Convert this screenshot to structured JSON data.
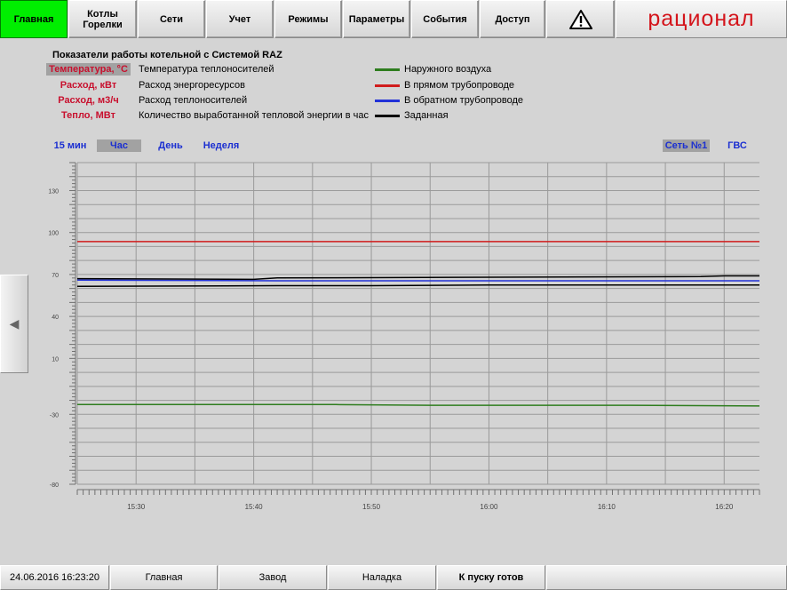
{
  "nav": {
    "items": [
      {
        "label": "Главная",
        "active": true
      },
      {
        "label": "Котлы\nГорелки"
      },
      {
        "label": "Сети"
      },
      {
        "label": "Учет"
      },
      {
        "label": "Режимы"
      },
      {
        "label": "Параметры"
      },
      {
        "label": "События"
      },
      {
        "label": "Доступ"
      }
    ],
    "alarm_icon": "warning-triangle-icon",
    "brand": "рационал"
  },
  "header": {
    "title": "Показатели работы котельной с Системой RAZ"
  },
  "legend": {
    "params": [
      {
        "name": "Температура, °С",
        "desc": "Температура теплоносителей",
        "selected": true
      },
      {
        "name": "Расход, кВт",
        "desc": "Расход энергоресурсов"
      },
      {
        "name": "Расход, м3/ч",
        "desc": "Расход теплоносителей"
      },
      {
        "name": "Тепло, МВт",
        "desc": "Количество выработанной тепловой энергии в час"
      }
    ],
    "series": [
      {
        "label": "Наружного воздуха",
        "color": "#2e7d1e"
      },
      {
        "label": "В прямом трубопроводе",
        "color": "#d01c1c"
      },
      {
        "label": "В обратном трубопроводе",
        "color": "#2232d8"
      },
      {
        "label": "Заданная",
        "color": "#000000"
      }
    ]
  },
  "periods": [
    {
      "label": "15 мин"
    },
    {
      "label": "Час",
      "selected": true
    },
    {
      "label": "День"
    },
    {
      "label": "Неделя"
    }
  ],
  "nets": [
    {
      "label": "Сеть №1",
      "selected": true
    },
    {
      "label": "ГВС"
    }
  ],
  "left_arrow": "◀",
  "chart_data": {
    "type": "line",
    "ylim": [
      -80,
      150
    ],
    "y_ticks": [
      -80,
      -30,
      10,
      40,
      70,
      100,
      130
    ],
    "x_range": [
      "15:25",
      "16:23"
    ],
    "x_ticks": [
      "15:30",
      "15:40",
      "15:50",
      "16:00",
      "16:10",
      "16:20"
    ],
    "grid": true,
    "series": [
      {
        "name": "Наружного воздуха",
        "color": "#2e7d1e",
        "x": [
          "15:25",
          "15:47",
          "15:55",
          "16:12",
          "16:23"
        ],
        "values": [
          -23.0,
          -23.0,
          -23.5,
          -23.5,
          -24.0
        ]
      },
      {
        "name": "В прямом трубопроводе",
        "color": "#d01c1c",
        "x": [
          "15:25",
          "16:23"
        ],
        "values": [
          93.5,
          93.5
        ]
      },
      {
        "name": "В обратном трубопроводе",
        "color": "#2232d8",
        "x": [
          "15:25",
          "15:42",
          "16:23"
        ],
        "values": [
          66.0,
          65.5,
          65.5
        ]
      },
      {
        "name": "Заданная",
        "color": "#000000",
        "x": [
          "15:25",
          "15:42",
          "15:50",
          "16:00",
          "16:18",
          "16:23"
        ],
        "values": [
          61.5,
          62.0,
          62.0,
          62.5,
          62.5,
          62.5
        ]
      },
      {
        "name": "Заданная",
        "color": "#000000",
        "x": [
          "15:25",
          "15:40",
          "15:42",
          "16:18",
          "16:20",
          "16:23"
        ],
        "values": [
          67.0,
          66.5,
          67.5,
          68.5,
          69.0,
          69.0
        ]
      }
    ]
  },
  "status": {
    "datetime": "24.06.2016 16:23:20",
    "items": [
      "Главная",
      "Завод",
      "Наладка",
      "К пуску готов"
    ]
  }
}
